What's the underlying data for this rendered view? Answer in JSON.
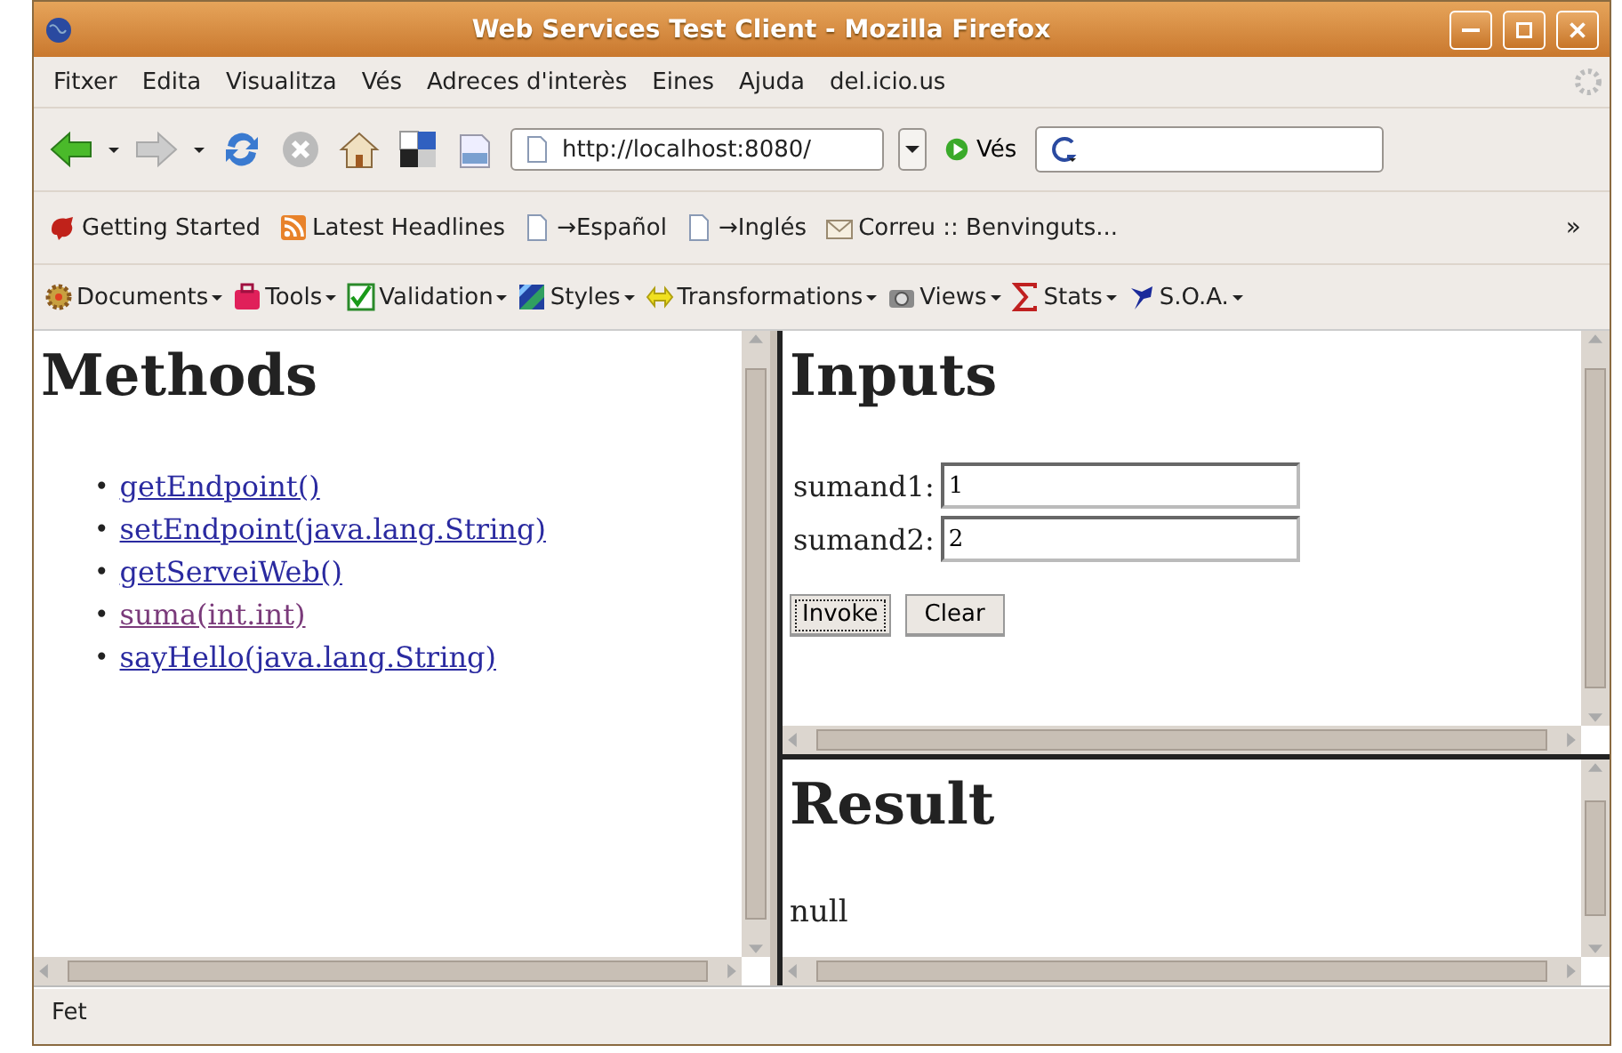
{
  "window": {
    "title": "Web Services Test Client - Mozilla Firefox"
  },
  "menu_bar": [
    {
      "label": "Fitxer"
    },
    {
      "label": "Edita"
    },
    {
      "label": "Visualitza"
    },
    {
      "label": "Vés"
    },
    {
      "label": "Adreces d'interès"
    },
    {
      "label": "Eines"
    },
    {
      "label": "Ajuda"
    },
    {
      "label": "del.icio.us"
    }
  ],
  "nav_toolbar": {
    "url": "http://localhost:8080/",
    "go_label": "Vés"
  },
  "bookmarks": [
    {
      "label": "Getting Started",
      "kind": "firefox"
    },
    {
      "label": "Latest Headlines",
      "kind": "rss"
    },
    {
      "label": "→Español",
      "kind": "page"
    },
    {
      "label": "→Inglés",
      "kind": "page"
    },
    {
      "label": "Correu :: Benvinguts...",
      "kind": "mail"
    }
  ],
  "bookmarks_overflow": "»",
  "ext_toolbar": [
    {
      "label": "Documents",
      "kind": "documents"
    },
    {
      "label": "Tools",
      "kind": "tools"
    },
    {
      "label": "Validation",
      "kind": "validation"
    },
    {
      "label": "Styles",
      "kind": "styles"
    },
    {
      "label": "Transformations",
      "kind": "transformations"
    },
    {
      "label": "Views",
      "kind": "views"
    },
    {
      "label": "Stats",
      "kind": "stats"
    },
    {
      "label": "S.O.A.",
      "kind": "soa"
    }
  ],
  "methods_frame": {
    "heading": "Methods",
    "links": [
      {
        "bullet": "•",
        "label": "getEndpoint()",
        "visited": false
      },
      {
        "bullet": "•",
        "label": "setEndpoint(java.lang.String)",
        "visited": false
      },
      {
        "bullet": "•",
        "label": "getServeiWeb()",
        "visited": false
      },
      {
        "bullet": "•",
        "label": "suma(int.int)",
        "visited": true
      },
      {
        "bullet": "•",
        "label": "sayHello(java.lang.String)",
        "visited": false
      }
    ]
  },
  "inputs_frame": {
    "heading": "Inputs",
    "fields": [
      {
        "label": "sumand1:",
        "value": "1"
      },
      {
        "label": "sumand2:",
        "value": "2"
      }
    ],
    "buttons": [
      {
        "label": "Invoke",
        "focused": true
      },
      {
        "label": "Clear",
        "focused": false
      }
    ]
  },
  "result_frame": {
    "heading": "Result",
    "text": "null"
  },
  "status_bar": "Fet"
}
